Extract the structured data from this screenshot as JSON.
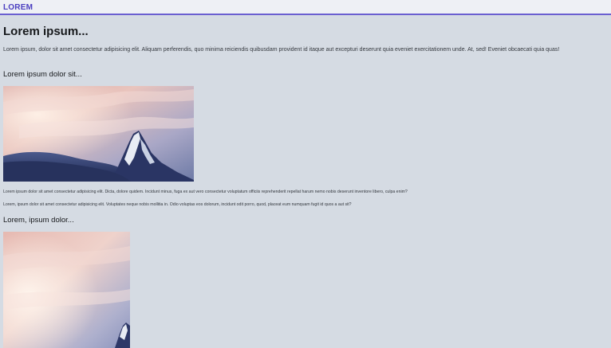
{
  "header": {
    "brand": "LOREM"
  },
  "main": {
    "title": "Lorem ipsum...",
    "intro": "Lorem ipsum, dolor sit amet consectetur adipisicing elit. Aliquam perferendis, quo minima reiciendis quibusdam provident id itaque aut excepturi deserunt quia eveniet exercitationem unde. At, sed! Eveniet obcaecati quia quas!",
    "section1": {
      "heading": "Lorem ipsum dolor sit...",
      "image_alt": "mountain-peak",
      "paragraph1": "Lorem ipsum dolor sit amet consectetur adipisicing elit. Dicta, dolore quidem. Incidunt minus, fuga ex aut vero consectetur voluptatum officiis reprehenderit repellat harum nemo nobis deserunt inventore libero, culpa enim?",
      "paragraph2": "Lorem, ipsum dolor sit amet consectetur adipisicing elit. Voluptates neque nobis mollitia in. Odio voluptas eos dolorum, incidunt odit porro, quod, placeat eum numquam fugit id quos a aut sit?"
    },
    "section2": {
      "heading": "Lorem, ipsum dolor...",
      "image_alt": "mountain-peak"
    }
  },
  "colors": {
    "background": "#d5dbe3",
    "topbar": "#eef0f5",
    "accent": "#6a5fd0",
    "brand": "#4b3fc0"
  }
}
